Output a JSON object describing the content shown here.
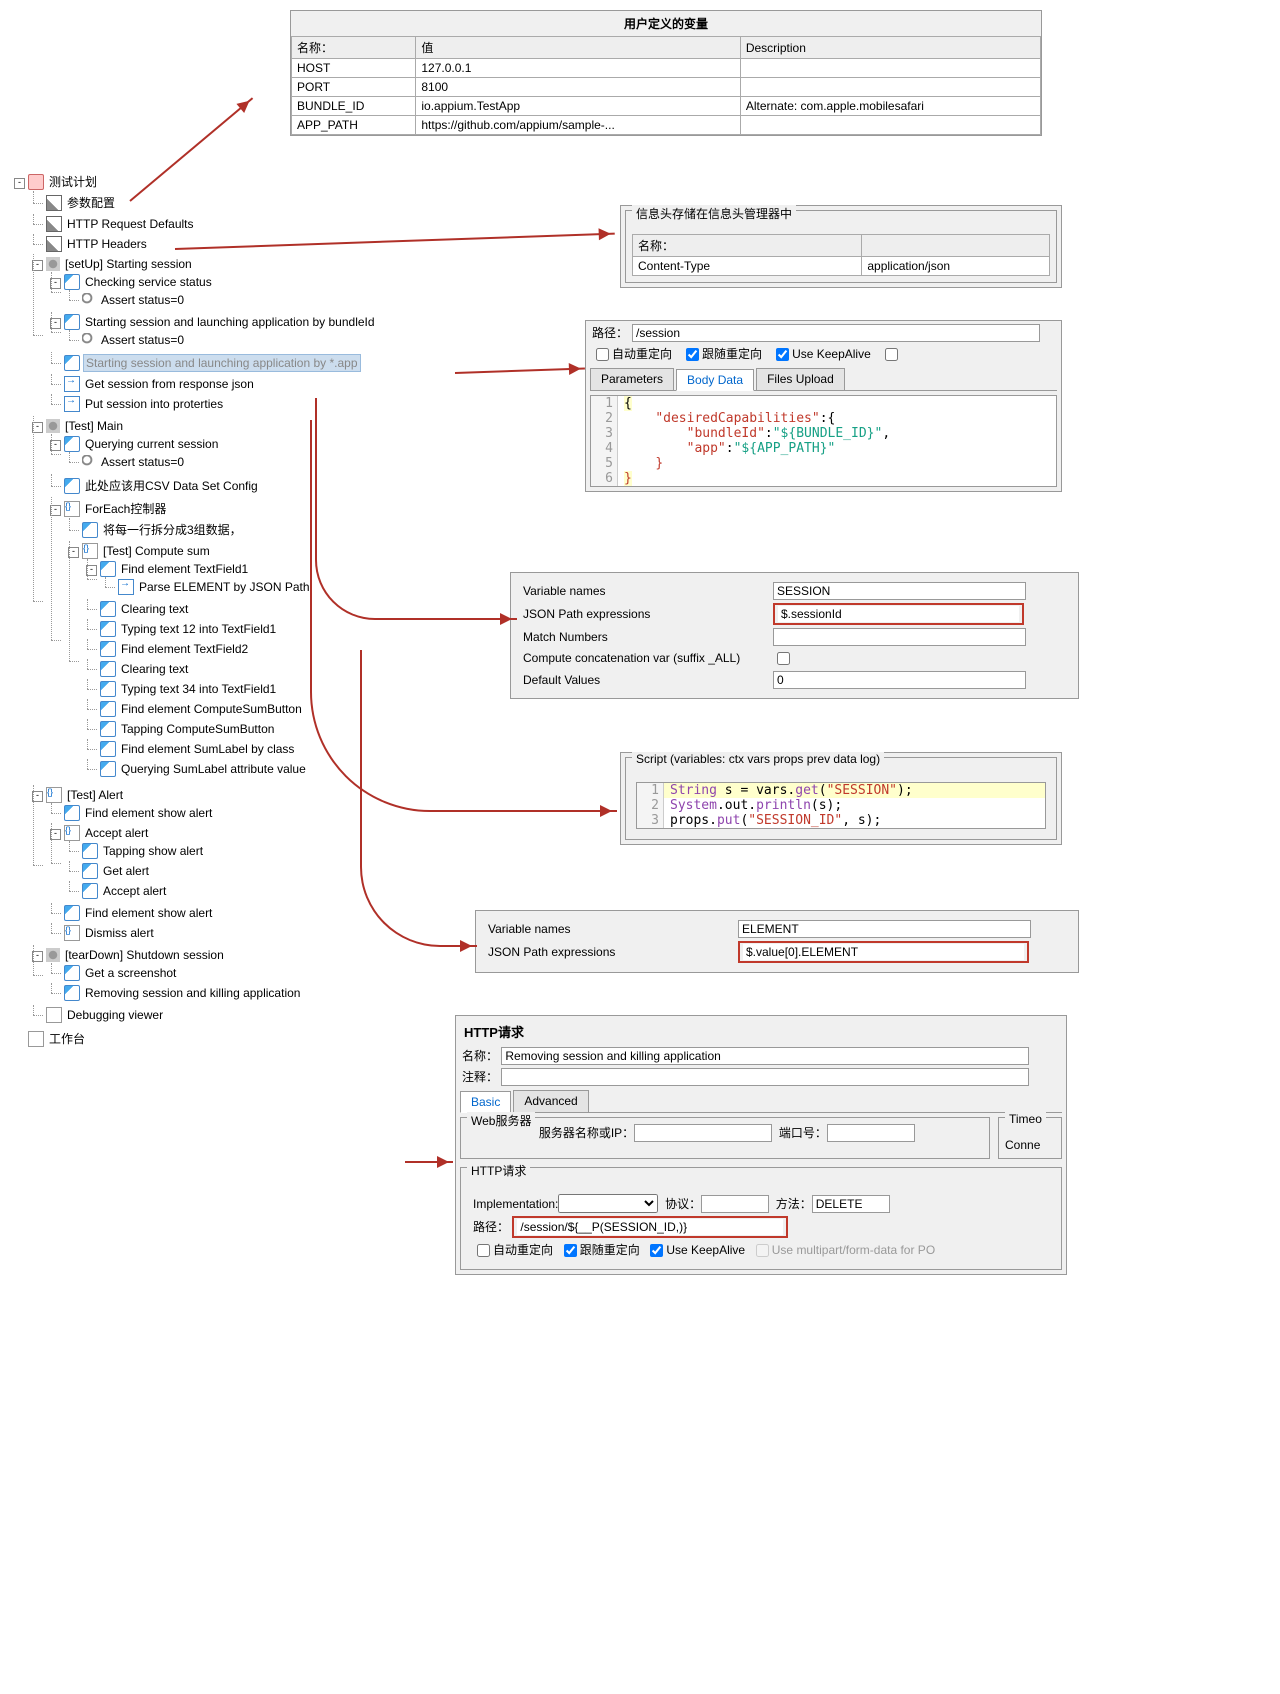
{
  "vars_panel": {
    "title": "用户定义的变量",
    "headers": [
      "名称：",
      "值",
      "Description"
    ],
    "rows": [
      [
        "HOST",
        "127.0.0.1",
        ""
      ],
      [
        "PORT",
        "8100",
        ""
      ],
      [
        "BUNDLE_ID",
        "io.appium.TestApp",
        "Alternate: com.apple.mobilesafari"
      ],
      [
        "APP_PATH",
        "https://github.com/appium/sample-...",
        ""
      ]
    ]
  },
  "headers_panel": {
    "title": "信息头存储在信息头管理器中",
    "h_name": "名称：",
    "h_value": "",
    "row_name": "Content-Type",
    "row_value": "application/json"
  },
  "session_panel": {
    "path_label": "路径：",
    "path_value": "/session",
    "cb1": "自动重定向",
    "cb2": "跟随重定向",
    "cb3": "Use KeepAlive",
    "tab1": "Parameters",
    "tab2": "Body Data",
    "tab3": "Files Upload",
    "code": [
      "{",
      "    \"desiredCapabilities\":{",
      "        \"bundleId\":\"${BUNDLE_ID}\",",
      "        \"app\":\"${APP_PATH}\"",
      "    }",
      "}"
    ]
  },
  "json1": {
    "l1": "Variable names",
    "v1": "SESSION",
    "l2": "JSON Path expressions",
    "v2": "$.sessionId",
    "l3": "Match Numbers",
    "v3": "",
    "l4": "Compute concatenation var (suffix _ALL)",
    "l5": "Default Values",
    "v5": "0"
  },
  "script_panel": {
    "title": "Script (variables: ctx vars props prev data log)",
    "lines": [
      "String s = vars.get(\"SESSION\");",
      "System.out.println(s);",
      "props.put(\"SESSION_ID\", s);"
    ]
  },
  "json2": {
    "l1": "Variable names",
    "v1": "ELEMENT",
    "l2": "JSON Path expressions",
    "v2": "$.value[0].ELEMENT"
  },
  "http_req": {
    "title": "HTTP请求",
    "name_label": "名称：",
    "name_value": "Removing session and killing application",
    "comment_label": "注释：",
    "comment_value": "",
    "tab_basic": "Basic",
    "tab_adv": "Advanced",
    "ws_title": "Web服务器",
    "server_label": "服务器名称或IP：",
    "port_label": "端口号：",
    "timeout": "Timeo",
    "connect": "Conne",
    "inner_title": "HTTP请求",
    "impl_label": "Implementation:",
    "proto_label": "协议：",
    "method_label": "方法：",
    "method_value": "DELETE",
    "path_label": "路径：",
    "path_value": "/session/${__P(SESSION_ID,)}",
    "cb1": "自动重定向",
    "cb2": "跟随重定向",
    "cb3": "Use KeepAlive",
    "cb4": "Use multipart/form-data for PO"
  },
  "tree": {
    "root": "测试计划",
    "n1": "参数配置",
    "n2": "HTTP Request Defaults",
    "n3": "HTTP Headers",
    "setup": "[setUp] Starting session",
    "s1": "Checking service status",
    "s1a": "Assert status=0",
    "s2": "Starting session and launching application by bundleId",
    "s2a": "Assert status=0",
    "s3": "Starting session and launching application by *.app",
    "s4": "Get session from response json",
    "s5": "Put session into proterties",
    "main": "[Test] Main",
    "m1": "Querying current session",
    "m1a": "Assert status=0",
    "m2": "此处应该用CSV Data Set Config",
    "m3": "ForEach控制器",
    "m3a": "将每一行拆分成3组数据，",
    "cs": "[Test] Compute sum",
    "c1": "Find element TextField1",
    "c1a": "Parse ELEMENT by JSON Path",
    "c2": "Clearing text",
    "c3": "Typing text 12 into TextField1",
    "c4": "Find element TextField2",
    "c5": "Clearing text",
    "c6": "Typing text 34 into TextField1",
    "c7": "Find element ComputeSumButton",
    "c8": "Tapping ComputeSumButton",
    "c9": "Find element SumLabel by class",
    "c10": "Querying SumLabel attribute value",
    "alert": "[Test] Alert",
    "a1": "Find element show alert",
    "a2": "Accept alert",
    "a2a": "Tapping show alert",
    "a2b": "Get alert",
    "a2c": "Accept alert",
    "a3": "Find element show alert",
    "a4": "Dismiss alert",
    "teardown": "[tearDown] Shutdown session",
    "t1": "Get a screenshot",
    "t2": "Removing session and killing application",
    "dbg": "Debugging viewer",
    "wb": "工作台"
  }
}
